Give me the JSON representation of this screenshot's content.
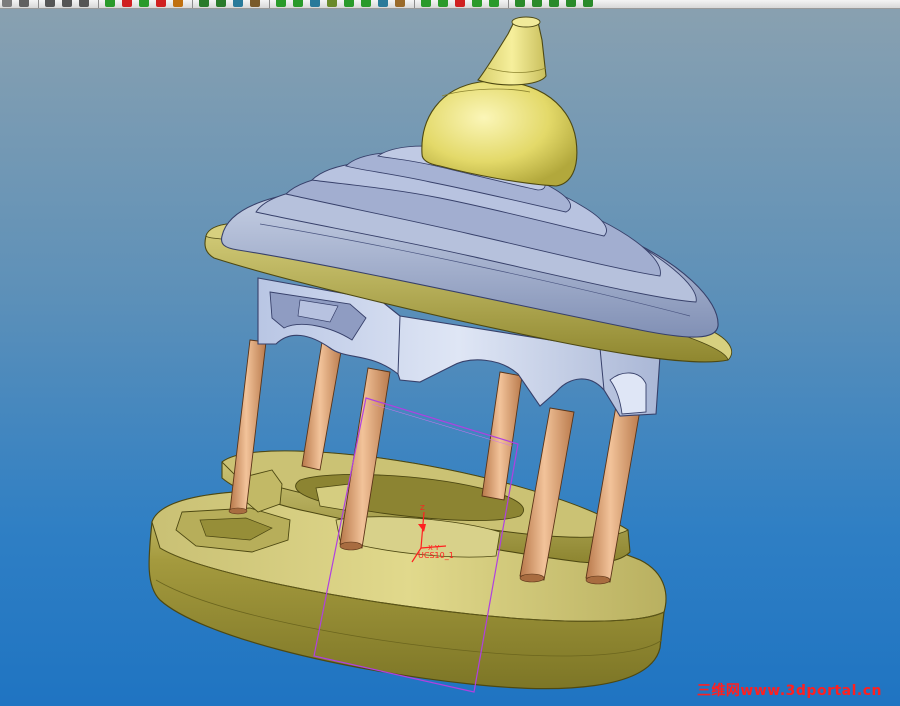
{
  "toolbar": {
    "buttons": [
      {
        "icon": "select-icon",
        "color": "#7c7c7c"
      },
      {
        "icon": "pointer-icon",
        "color": "#606060"
      },
      {
        "sep": true
      },
      {
        "icon": "undo-icon",
        "color": "#555555"
      },
      {
        "icon": "redo-icon",
        "color": "#555555"
      },
      {
        "icon": "refresh-icon",
        "color": "#555555"
      },
      {
        "sep": true
      },
      {
        "icon": "sketch-icon",
        "color": "#2a9a2a"
      },
      {
        "icon": "line-icon",
        "color": "#d02020"
      },
      {
        "icon": "arc-icon",
        "color": "#2a9a2a"
      },
      {
        "icon": "circle-icon",
        "color": "#d02020"
      },
      {
        "icon": "spline-icon",
        "color": "#c07010"
      },
      {
        "sep": true
      },
      {
        "icon": "point-icon",
        "color": "#2a7a2a"
      },
      {
        "icon": "axis-icon",
        "color": "#2a7a2a"
      },
      {
        "icon": "plane-icon",
        "color": "#2a7a9a"
      },
      {
        "icon": "coordsys-icon",
        "color": "#7a5a2a"
      },
      {
        "sep": true
      },
      {
        "icon": "extrude-icon",
        "color": "#2a9a2a"
      },
      {
        "icon": "revolve-icon",
        "color": "#2a9a2a"
      },
      {
        "icon": "sweep-icon",
        "color": "#2a7a9a"
      },
      {
        "icon": "blend-icon",
        "color": "#6a8a2a"
      },
      {
        "icon": "hole-icon",
        "color": "#2a9a2a"
      },
      {
        "icon": "shell-icon",
        "color": "#2a9a2a"
      },
      {
        "icon": "rib-icon",
        "color": "#2a7a9a"
      },
      {
        "icon": "draft-icon",
        "color": "#9a6a2a"
      },
      {
        "sep": true
      },
      {
        "icon": "round-icon",
        "color": "#2a9a2a"
      },
      {
        "icon": "chamfer-icon",
        "color": "#2a9a2a"
      },
      {
        "icon": "pattern-icon",
        "color": "#d02020"
      },
      {
        "icon": "mirror-icon",
        "color": "#2a9a2a"
      },
      {
        "icon": "merge-icon",
        "color": "#2a9a2a"
      },
      {
        "sep": true
      },
      {
        "icon": "layer-icon",
        "color": "#2a8a2a"
      },
      {
        "icon": "view-icon",
        "color": "#2a8a2a"
      },
      {
        "icon": "orient-icon",
        "color": "#2a8a2a"
      },
      {
        "icon": "zoom-icon",
        "color": "#2a8a2a"
      },
      {
        "icon": "spin-icon",
        "color": "#2a8a2a"
      }
    ]
  },
  "model": {
    "csys_axis_label": "Z",
    "csys_label": "UCS10_1",
    "csys_axes": "X Y"
  },
  "watermark": "三维网www.3dportal.cn",
  "colors": {
    "gold": "#9a9434",
    "gold_light": "#d8d07a",
    "roof": "#a9b5d0",
    "roof_dark": "#6f7fa4",
    "column": "#e2a877",
    "dome": "#e8e072",
    "sketch": "#b040e0",
    "csys": "#ff2020"
  }
}
